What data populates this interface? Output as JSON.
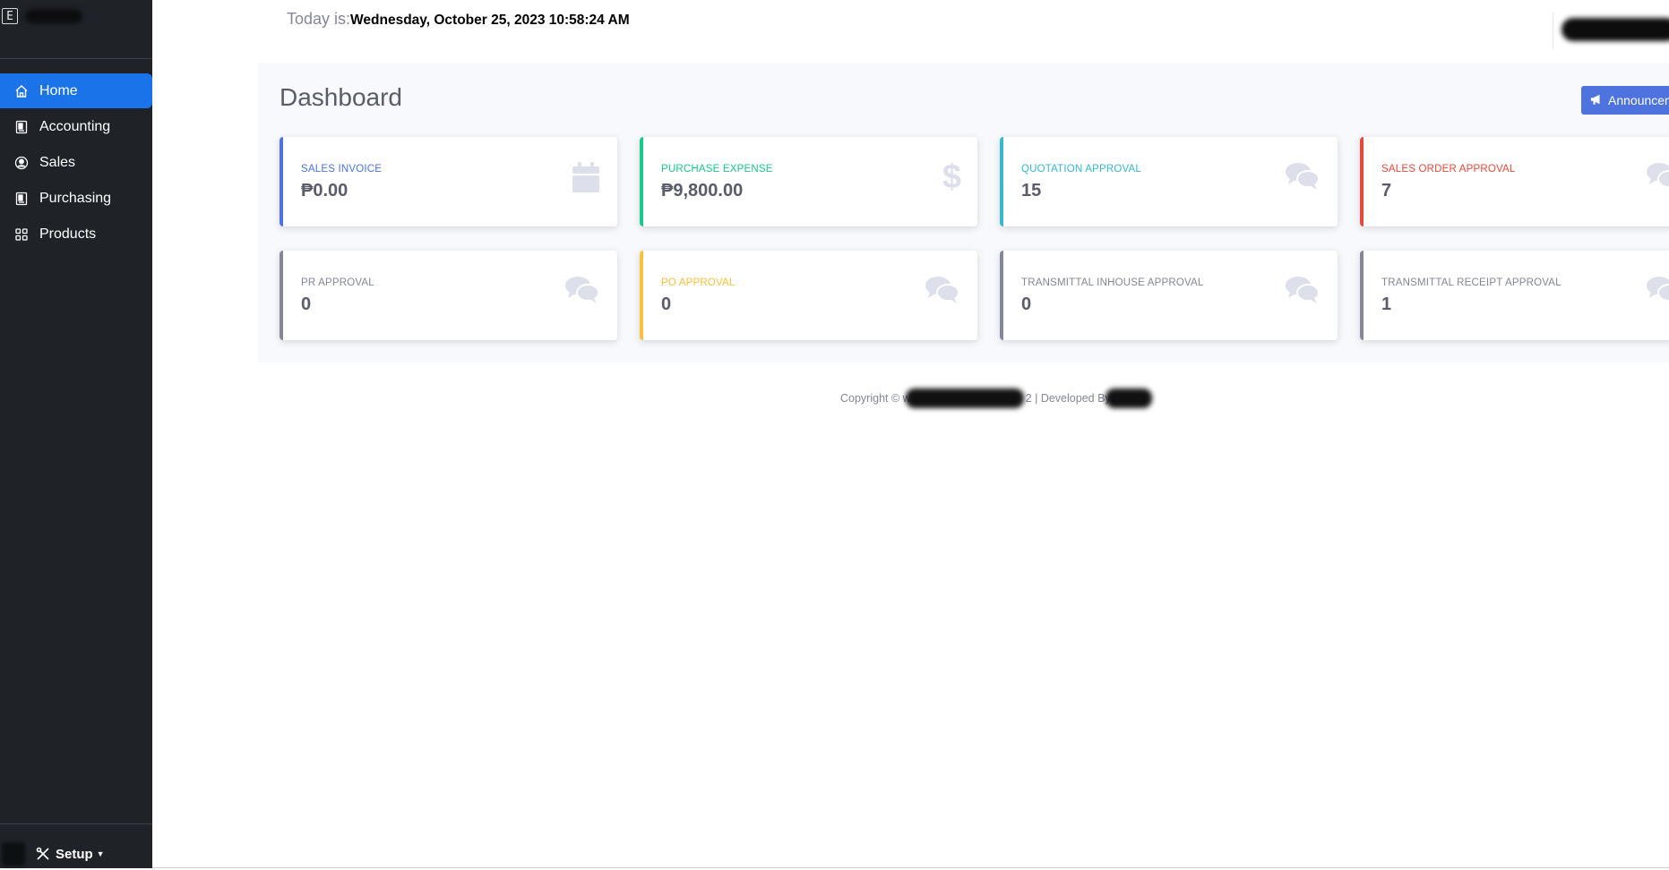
{
  "brand": {
    "logo_letter": "E"
  },
  "sidebar": {
    "items": [
      {
        "label": "Home",
        "icon": "home-icon",
        "active": true
      },
      {
        "label": "Accounting",
        "icon": "ledger-icon",
        "active": false
      },
      {
        "label": "Sales",
        "icon": "user-circle-icon",
        "active": false
      },
      {
        "label": "Purchasing",
        "icon": "ledger-icon",
        "active": false
      },
      {
        "label": "Products",
        "icon": "grid-icon",
        "active": false
      }
    ],
    "setup_label": "Setup"
  },
  "header": {
    "today_label": "Today is:",
    "today_value": "Wednesday, October 25, 2023 10:58:24 AM"
  },
  "main": {
    "title": "Dashboard",
    "announce_button": "Announcem",
    "cards": [
      {
        "label": "SALES INVOICE",
        "value": "₱0.00",
        "color": "#4e73df",
        "icon": "calendar-icon"
      },
      {
        "label": "PURCHASE EXPENSE",
        "value": "₱9,800.00",
        "color": "#1cc88a",
        "icon": "dollar-icon"
      },
      {
        "label": "QUOTATION APPROVAL",
        "value": "15",
        "color": "#36b9cc",
        "icon": "comments-icon"
      },
      {
        "label": "SALES ORDER APPROVAL",
        "value": "7",
        "color": "#e74a3b",
        "icon": "comments-icon"
      },
      {
        "label": "PR APPROVAL",
        "value": "0",
        "color": "#858796",
        "icon": "comments-icon"
      },
      {
        "label": "PO APPROVAL",
        "value": "0",
        "color": "#f6c23e",
        "icon": "comments-icon"
      },
      {
        "label": "TRANSMITTAL INHOUSE APPROVAL",
        "value": "0",
        "color": "#858796",
        "icon": "comments-icon"
      },
      {
        "label": "TRANSMITTAL RECEIPT APPROVAL",
        "value": "1",
        "color": "#858796",
        "icon": "comments-icon"
      }
    ]
  },
  "footer": {
    "copyright_prefix": "Copyright © w",
    "copyright_suffix": "2 | Developed By"
  }
}
